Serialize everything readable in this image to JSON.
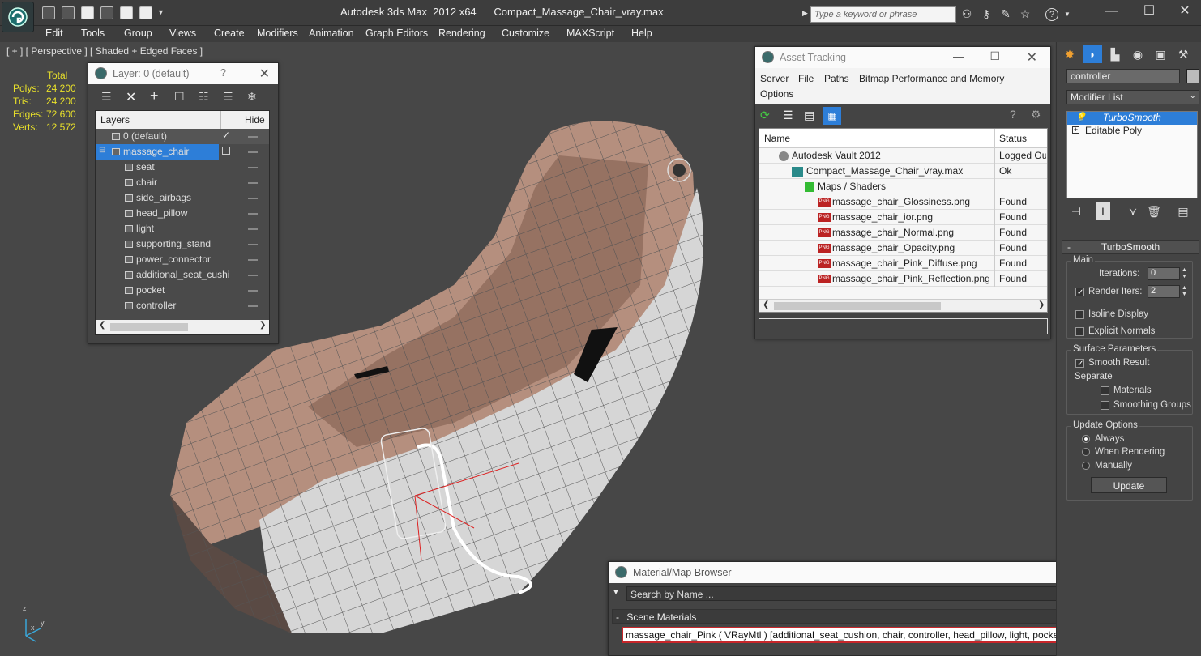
{
  "title_bar": {
    "app_title": "Autodesk 3ds Max  2012 x64      Compact_Massage_Chair_vray.max",
    "search_placeholder": "Type a keyword or phrase"
  },
  "menu": [
    "Edit",
    "Tools",
    "Group",
    "Views",
    "Create",
    "Modifiers",
    "Animation",
    "Graph Editors",
    "Rendering",
    "Customize",
    "MAXScript",
    "Help"
  ],
  "viewport": {
    "label": "[ + ] [ Perspective ] [ Shaded + Edged Faces ]",
    "stats_header": "Total",
    "stats": [
      {
        "label": "Polys:",
        "value": "24 200"
      },
      {
        "label": "Tris:",
        "value": "24 200"
      },
      {
        "label": "Edges:",
        "value": "72 600"
      },
      {
        "label": "Verts:",
        "value": "12 572"
      }
    ],
    "axis_labels": {
      "z": "z",
      "x": "x",
      "y": "y"
    }
  },
  "layer_window": {
    "title": "Layer: 0 (default)",
    "help": "?",
    "col_layers": "Layers",
    "col_hide": "Hide",
    "layers": [
      {
        "name": "0 (default)",
        "level": 0
      },
      {
        "name": "massage_chair",
        "level": 0
      }
    ],
    "objects": [
      "seat",
      "chair",
      "side_airbags",
      "head_pillow",
      "light",
      "supporting_stand",
      "power_connector",
      "additional_seat_cushi",
      "pocket",
      "controller"
    ]
  },
  "asset_tracking": {
    "title": "Asset Tracking",
    "menu": [
      "Server",
      "File",
      "Paths",
      "Bitmap Performance and Memory",
      "Options"
    ],
    "col_name": "Name",
    "col_status": "Status",
    "rows": [
      {
        "name": "Autodesk Vault 2012",
        "status": "Logged Out",
        "level": 0,
        "icon": "vault"
      },
      {
        "name": "Compact_Massage_Chair_vray.max",
        "status": "Ok",
        "level": 1,
        "icon": "max"
      },
      {
        "name": "Maps / Shaders",
        "status": "",
        "level": 2,
        "icon": "maps"
      },
      {
        "name": "massage_chair_Glossiness.png",
        "status": "Found",
        "level": 3,
        "icon": "png"
      },
      {
        "name": "massage_chair_ior.png",
        "status": "Found",
        "level": 3,
        "icon": "png"
      },
      {
        "name": "massage_chair_Normal.png",
        "status": "Found",
        "level": 3,
        "icon": "png"
      },
      {
        "name": "massage_chair_Opacity.png",
        "status": "Found",
        "level": 3,
        "icon": "png"
      },
      {
        "name": "massage_chair_Pink_Diffuse.png",
        "status": "Found",
        "level": 3,
        "icon": "png"
      },
      {
        "name": "massage_chair_Pink_Reflection.png",
        "status": "Found",
        "level": 3,
        "icon": "png"
      }
    ]
  },
  "material_browser": {
    "title": "Material/Map Browser",
    "search_placeholder": "Search by Name ...",
    "section": "Scene Materials",
    "section_toggle": "-",
    "entry": "massage_chair_Pink ( VRayMtl ) [additional_seat_cushion, chair, controller, head_pillow, light, pocket, power_connector, seat, side_ai"
  },
  "command_panel": {
    "object_name": "controller",
    "modifier_list": "Modifier List",
    "stack": [
      "TurboSmooth",
      "Editable Poly"
    ],
    "rollout_title": "TurboSmooth",
    "rollout_toggle": "-",
    "main_group": "Main",
    "iterations_label": "Iterations:",
    "iterations_value": "0",
    "render_iters_label": "Render Iters:",
    "render_iters_value": "2",
    "render_iters_checked": true,
    "isoline_label": "Isoline Display",
    "explicit_normals_label": "Explicit Normals",
    "surface_group": "Surface Parameters",
    "smooth_result_label": "Smooth Result",
    "separate_label": "Separate",
    "materials_label": "Materials",
    "smoothing_groups_label": "Smoothing Groups",
    "update_group": "Update Options",
    "always_label": "Always",
    "when_rendering_label": "When Rendering",
    "manually_label": "Manually",
    "update_button": "Update"
  },
  "colors": {
    "accent_blue": "#2d7ed8",
    "stats_yellow": "#e8e02a",
    "chair_pink": "#b08a78",
    "chair_white": "#cfcfcf",
    "material_red": "#c8262a"
  }
}
